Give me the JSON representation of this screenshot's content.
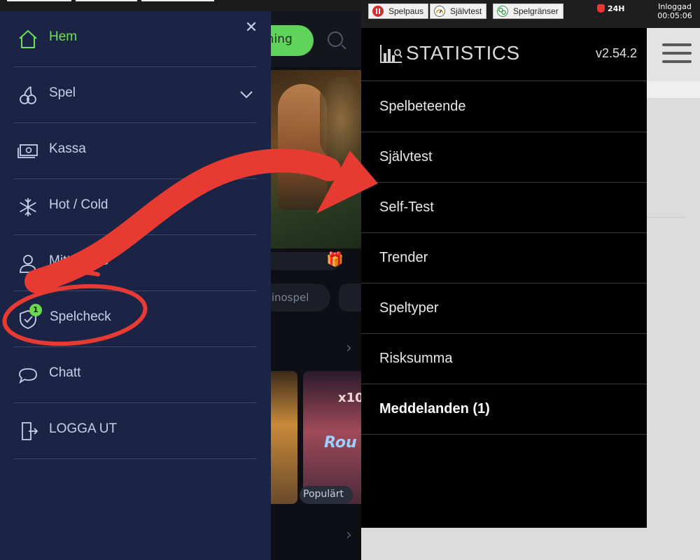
{
  "casino": {
    "cta_partial": "tning",
    "chip_partial": "sinospel",
    "popular_label": "Populärt",
    "thumb_text_1": "x10",
    "thumb_text_2": "Rou"
  },
  "drawer": {
    "items": [
      {
        "label": "Hem",
        "icon": "home-icon",
        "active": true
      },
      {
        "label": "Spel",
        "icon": "cherries-icon",
        "expandable": true
      },
      {
        "label": "Kassa",
        "icon": "banknotes-icon"
      },
      {
        "label": "Hot / Cold",
        "icon": "snowflake-icon"
      },
      {
        "label": "Mitt Konto",
        "icon": "user-icon"
      },
      {
        "label": "Spelcheck",
        "icon": "shield-check-icon",
        "badge": "1"
      },
      {
        "label": "Chatt",
        "icon": "chat-bubble-icon"
      },
      {
        "label": "LOGGA UT",
        "icon": "logout-icon"
      }
    ]
  },
  "statsbar": {
    "chips": [
      {
        "label": "Spelpaus",
        "icon": "pause-icon",
        "color": "#d32f2f"
      },
      {
        "label": "Självtest",
        "icon": "gauge-icon",
        "color": "#c9a227"
      },
      {
        "label": "Spelgränser",
        "icon": "limits-icon",
        "color": "#2e9a3a"
      }
    ],
    "limit_label": "24H",
    "login_label": "Inloggad",
    "session_time": "00:05:06"
  },
  "stats_app": {
    "title": "STATISTICS",
    "version": "v2.54.2",
    "menu": [
      {
        "label": "Spelbeteende"
      },
      {
        "label": "Självtest"
      },
      {
        "label": "Self-Test"
      },
      {
        "label": "Trender"
      },
      {
        "label": "Speltyper"
      },
      {
        "label": "Risksumma"
      },
      {
        "label": "Meddelanden (1)",
        "bold": true
      }
    ]
  },
  "colors": {
    "annotation_red": "#e63a32",
    "drawer_bg": "#1b2444",
    "active_green": "#6fe05a"
  }
}
